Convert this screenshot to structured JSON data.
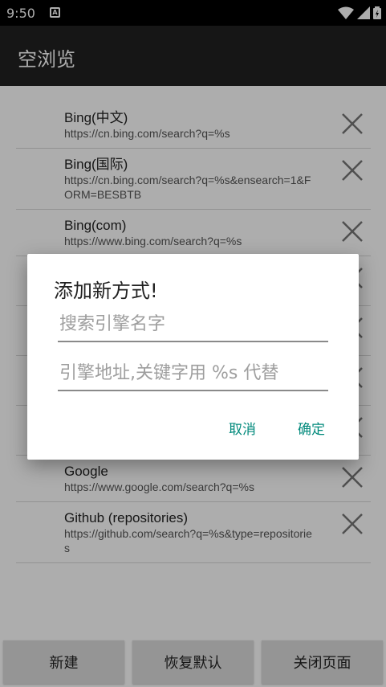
{
  "status_bar": {
    "time": "9:50",
    "notification_icon": "a-icon",
    "icons": [
      "wifi-icon",
      "signal-icon",
      "battery-icon"
    ]
  },
  "app_bar": {
    "title": "空浏览"
  },
  "engines": [
    {
      "name": "Bing(中文)",
      "url": "https://cn.bing.com/search?q=%s"
    },
    {
      "name": "Bing(国际)",
      "url": "https://cn.bing.com/search?q=%s&ensearch=1&FORM=BESBTB"
    },
    {
      "name": "Bing(com)",
      "url": "https://www.bing.com/search?q=%s"
    },
    {
      "name": "",
      "url": ""
    },
    {
      "name": "",
      "url": ""
    },
    {
      "name": "",
      "url": ""
    },
    {
      "name": "",
      "url": ""
    },
    {
      "name": "Google",
      "url": "https://www.google.com/search?q=%s"
    },
    {
      "name": "Github (repositories)",
      "url": "https://github.com/search?q=%s&type=repositories"
    }
  ],
  "bottom_bar": {
    "new_label": "新建",
    "restore_label": "恢复默认",
    "close_label": "关闭页面"
  },
  "dialog": {
    "title": "添加新方式!",
    "name_placeholder": "搜索引擎名字",
    "url_placeholder": "引擎地址,关键字用 %s 代替",
    "cancel_label": "取消",
    "ok_label": "确定"
  },
  "colors": {
    "app_bar": "#212121",
    "accent": "#00897b",
    "scrim": "rgba(0,0,0,0.32)"
  }
}
